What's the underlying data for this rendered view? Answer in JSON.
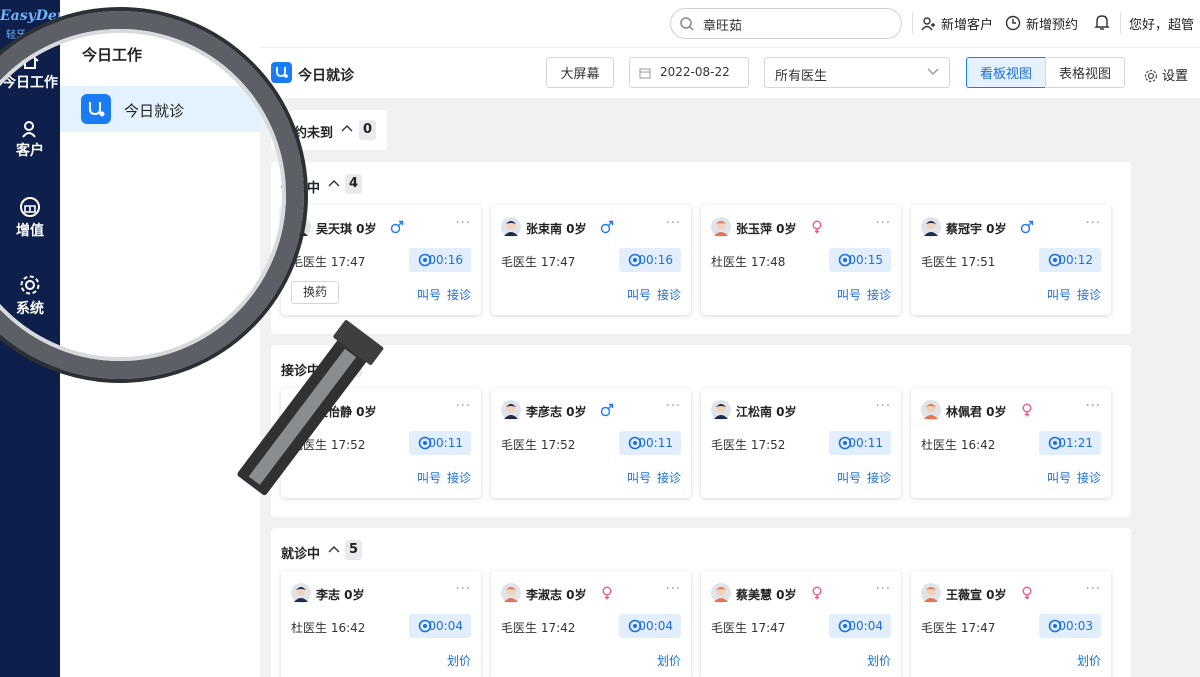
{
  "nav": {
    "logo_text": "EasyDent",
    "logo_sub": "轻牙",
    "items": [
      {
        "label": "今日工作",
        "icon": "home-icon"
      },
      {
        "label": "客户",
        "icon": "user-icon"
      },
      {
        "label": "增值",
        "icon": "gift-icon"
      },
      {
        "label": "系统",
        "icon": "gear-icon"
      }
    ]
  },
  "submenu": {
    "title": "今日工作",
    "items": [
      {
        "label": "今日就诊",
        "icon": "stethoscope-icon"
      }
    ]
  },
  "header": {
    "search_value": "章旺茹",
    "new_customer": "新增客户",
    "new_appointment": "新增预约",
    "greeting": "您好，超管"
  },
  "toolbar": {
    "title": "今日就诊",
    "big_screen": "大屏幕",
    "date": "2022-08-22",
    "doctor_select": "所有医生",
    "view_board": "看板视图",
    "view_table": "表格视图",
    "settings": "设置"
  },
  "colors": {
    "accent": "#1a7cf5",
    "nav_bg": "#0d1f4a",
    "male": "#1a7cf5",
    "female": "#f0578c"
  },
  "groups": [
    {
      "title": "预约未到",
      "count": "0",
      "cards": []
    },
    {
      "title": "候诊中",
      "count": "4",
      "cards": [
        {
          "name": "吴天琪 0岁",
          "gender": "male",
          "avatar": "male",
          "doctor": "毛医生 17:47",
          "timer": "00:16",
          "actions": [
            "叫号",
            "接诊"
          ],
          "tag": "换药"
        },
        {
          "name": "张束南 0岁",
          "gender": "male",
          "avatar": "male",
          "doctor": "毛医生 17:47",
          "timer": "00:16",
          "actions": [
            "叫号",
            "接诊"
          ]
        },
        {
          "name": "张玉萍 0岁",
          "gender": "female",
          "avatar": "female",
          "doctor": "杜医生 17:48",
          "timer": "00:15",
          "actions": [
            "叫号",
            "接诊"
          ]
        },
        {
          "name": "蔡冠宇 0岁",
          "gender": "male",
          "avatar": "male",
          "doctor": "毛医生 17:51",
          "timer": "00:12",
          "actions": [
            "叫号",
            "接诊"
          ]
        }
      ]
    },
    {
      "title": "接诊中",
      "count": "4",
      "cards": [
        {
          "name": "史怡静 0岁",
          "gender": "",
          "avatar": "female",
          "doctor": "毛医生 17:52",
          "timer": "00:11",
          "actions": [
            "叫号",
            "接诊"
          ]
        },
        {
          "name": "李彦志 0岁",
          "gender": "male",
          "avatar": "male",
          "doctor": "毛医生 17:52",
          "timer": "00:11",
          "actions": [
            "叫号",
            "接诊"
          ]
        },
        {
          "name": "江松南 0岁",
          "gender": "",
          "avatar": "male",
          "doctor": "毛医生 17:52",
          "timer": "00:11",
          "actions": [
            "叫号",
            "接诊"
          ]
        },
        {
          "name": "林佩君 0岁",
          "gender": "female",
          "avatar": "female",
          "doctor": "杜医生 16:42",
          "timer": "01:21",
          "actions": [
            "叫号",
            "接诊"
          ]
        }
      ]
    },
    {
      "title": "就诊中",
      "count": "5",
      "cards": [
        {
          "name": "李志 0岁",
          "gender": "",
          "avatar": "male",
          "doctor": "杜医生 16:42",
          "timer": "00:04",
          "actions": [
            "划价"
          ]
        },
        {
          "name": "李淑志 0岁",
          "gender": "female",
          "avatar": "female",
          "doctor": "毛医生 17:42",
          "timer": "00:04",
          "actions": [
            "划价"
          ]
        },
        {
          "name": "蔡美慧 0岁",
          "gender": "female",
          "avatar": "female",
          "doctor": "毛医生 17:47",
          "timer": "00:04",
          "actions": [
            "划价"
          ]
        },
        {
          "name": "王薇宣 0岁",
          "gender": "female",
          "avatar": "female",
          "doctor": "毛医生 17:47",
          "timer": "00:03",
          "actions": [
            "划价"
          ]
        }
      ]
    }
  ]
}
